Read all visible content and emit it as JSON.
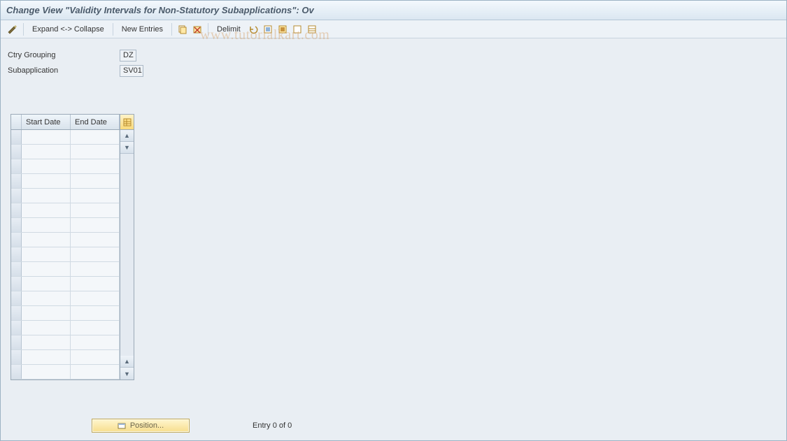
{
  "title": "Change View \"Validity Intervals for Non-Statutory Subapplications\": Ov",
  "toolbar": {
    "expand_collapse": "Expand <-> Collapse",
    "new_entries": "New Entries",
    "delimit": "Delimit"
  },
  "form": {
    "ctry_grouping_label": "Ctry Grouping",
    "ctry_grouping_value": "DZ",
    "subapplication_label": "Subapplication",
    "subapplication_value": "SV01"
  },
  "table": {
    "col_start": "Start Date",
    "col_end": "End Date",
    "row_count": 17
  },
  "footer": {
    "position_label": "Position...",
    "entry_text": "Entry 0 of 0"
  },
  "watermark": "www.tutorialkart.com"
}
